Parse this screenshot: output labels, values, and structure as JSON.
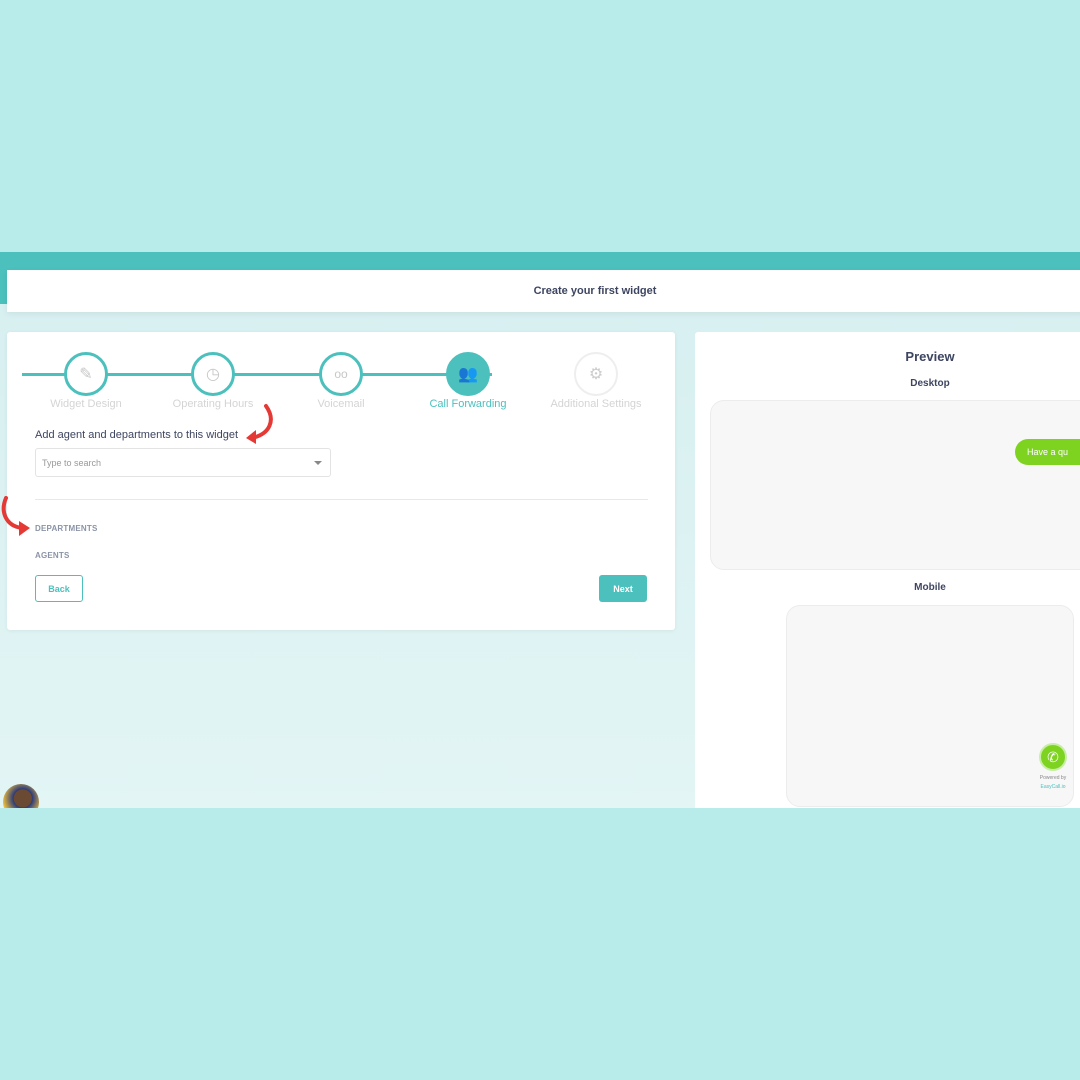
{
  "header": {
    "title": "Create your first widget"
  },
  "steps": [
    {
      "label": "Widget Design",
      "icon": "pencil-ruler-icon",
      "state": "done"
    },
    {
      "label": "Operating Hours",
      "icon": "clock-icon",
      "state": "done"
    },
    {
      "label": "Voicemail",
      "icon": "voicemail-icon",
      "state": "done"
    },
    {
      "label": "Call Forwarding",
      "icon": "users-icon",
      "state": "active"
    },
    {
      "label": "Additional Settings",
      "icon": "gear-icon",
      "state": "todo"
    }
  ],
  "form": {
    "heading": "Add agent and departments to this widget",
    "search_placeholder": "Type to search",
    "departments": "DEPARTMENTS",
    "agents": "AGENTS",
    "back": "Back",
    "next": "Next"
  },
  "preview": {
    "title": "Preview",
    "desktop": "Desktop",
    "mobile": "Mobile",
    "bubble": "Have a qu",
    "powered": "Powered by",
    "brand": "EasyCall.io"
  },
  "colors": {
    "accent": "#4bc0bd",
    "green": "#7ed321",
    "arrow": "#e53935",
    "background": "#b8ecea"
  }
}
